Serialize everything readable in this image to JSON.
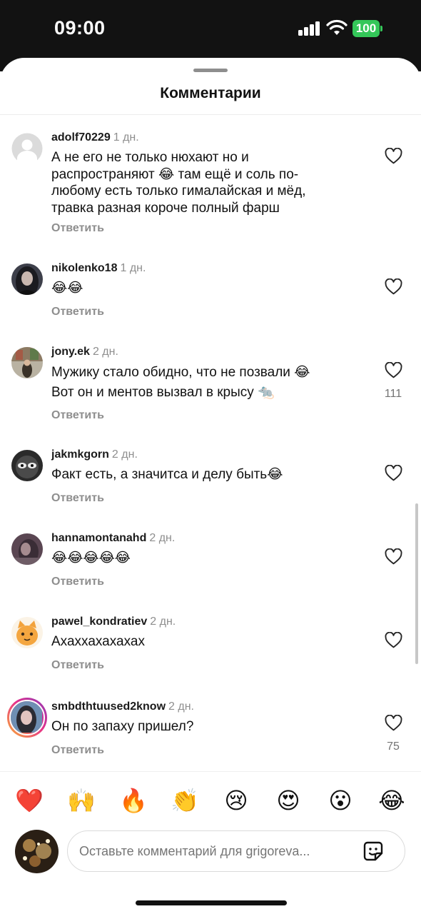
{
  "status": {
    "time": "09:00",
    "battery": "100"
  },
  "sheet": {
    "title": "Комментарии"
  },
  "reply_label": "Ответить",
  "comments": [
    {
      "username": "adolf70229",
      "time": "1 дн.",
      "text": "А не его не только нюхают но и распространяют 😂 там ещё и соль по-любому есть только гималайская и мёд, травка разная короче полный фарш",
      "likes": ""
    },
    {
      "username": "nikolenko18",
      "time": "1 дн.",
      "text": "😂😂",
      "likes": ""
    },
    {
      "username": "jony.ek",
      "time": "2 дн.",
      "text": "Мужику стало обидно, что не позвали 😂",
      "text2": "Вот он и ментов вызвал в крысу 🐀",
      "likes": "111"
    },
    {
      "username": "jakmkgorn",
      "time": "2 дн.",
      "text": "Факт есть, а значитса и делу быть😂",
      "likes": ""
    },
    {
      "username": "hannamontanahd",
      "time": "2 дн.",
      "text": "😂😂😂😂😂",
      "likes": ""
    },
    {
      "username": "pawel_kondratiev",
      "time": "2 дн.",
      "text": "Ахаххахахахах",
      "likes": ""
    },
    {
      "username": "smbdthtuused2know",
      "time": "2 дн.",
      "text": "Он по запаху пришел?",
      "likes": "75"
    }
  ],
  "reactions": [
    "❤️",
    "🙌",
    "🔥",
    "👏",
    "😢",
    "😍",
    "😮",
    "😂"
  ],
  "composer": {
    "placeholder": "Оставьте комментарий для grigoreva..."
  },
  "icons": [
    "signal-icon",
    "wifi-icon",
    "battery-icon",
    "heart-outline-icon",
    "sticker-icon",
    "default-avatar-icon"
  ],
  "colors": {
    "status_bar": "#121212",
    "battery": "#34c759",
    "muted_text": "#8e8e8e",
    "story_ring": "#e6308a"
  }
}
